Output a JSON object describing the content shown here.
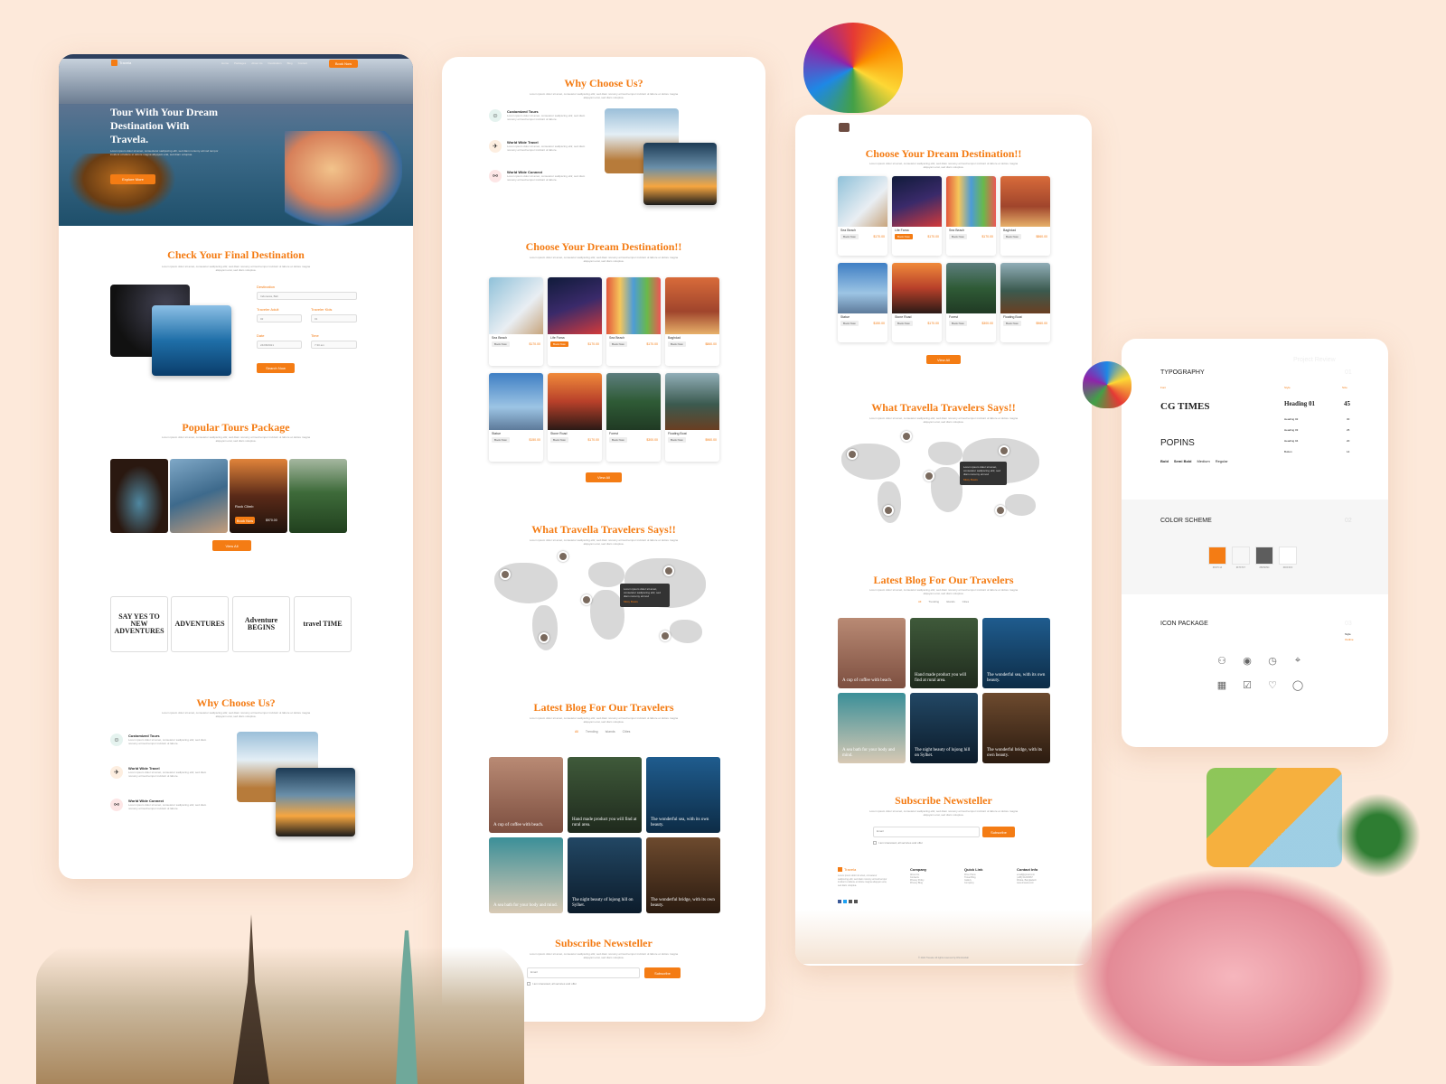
{
  "hero": {
    "brand": "Travela",
    "nav": [
      "Home",
      "Packages",
      "About Us",
      "Destination",
      "Blog",
      "Contact"
    ],
    "nav_button": "Book Now",
    "title": "Tour With Your Dream Destination With Travela.",
    "text": "Lorem ipsum dolor sit amet, consectetur sadipscing elitr, sed diam nonumy eirmod tempor invidunt ut labore et dolore magna aliquyam erat, sed diam voluptua.",
    "cta": "Explore More"
  },
  "check": {
    "title": "Check Your Final Destination",
    "text": "Lorem ipsum dolor sit amet, consetetur sadipscing elitr, sed diam nonumy eirmod tempor invidunt ut labore et dolore magna aliquyam erat, sed diam voluptua.",
    "destination_label": "Destination",
    "destination_value": "Indonesia, Bali",
    "adult_label": "Traveler Adult",
    "adult_value": "02",
    "kids_label": "Traveler Kids",
    "kids_value": "01",
    "date_label": "Date",
    "date_value": "24/08/2021",
    "time_label": "Time",
    "time_value": "7:30 am",
    "button": "Search Now"
  },
  "popular": {
    "title": "Popular Tours Package",
    "text": "Lorem ipsum dolor sit amet, consetetur sadipscing elitr, sed diam nonumy eirmod tempor invidunt ut labore et dolore magna aliquyam erat, sed diam voluptua.",
    "featured_name": "Rock Climb",
    "featured_button": "Book Now",
    "featured_price": "$970.00",
    "button": "View All"
  },
  "logos": [
    "SAY YES TO NEW ADVENTURES",
    "ADVENTURES",
    "Adventure BEGINS",
    "travel TIME"
  ],
  "why": {
    "title": "Why Choose Us?",
    "text": "Lorem ipsum dolor sit amet, consetetur sadipscing elitr, sed diam nonumy eirmod tempor invidunt ut labore et dolore magna aliquyam erat, sed diam voluptua.",
    "features": [
      {
        "title": "Customized Tours",
        "text": "Lorem ipsum dolor sit amet, consetetur sadipscing elitr, sed diam nonumy eirmod tempor invidunt ut labore."
      },
      {
        "title": "World Wide Travel",
        "text": "Lorem ipsum dolor sit amet, consetetur sadipscing elitr, sed diam nonumy eirmod tempor invidunt ut labore."
      },
      {
        "title": "World Wide Connect",
        "text": "Lorem ipsum dolor sit amet, consetetur sadipscing elitr, sed diam nonumy eirmod tempor invidunt ut labore."
      }
    ]
  },
  "dream": {
    "title": "Choose Your Dream Destination!!",
    "text": "Lorem ipsum dolor sit amet, consetetur sadipscing elitr, sed diam nonumy eirmod tempor invidunt ut labore et dolore magna aliquyam erat, sed diam voluptua.",
    "cards": [
      {
        "name": "Sea Beach",
        "price": "$170.00",
        "book": "Book Now"
      },
      {
        "name": "Life Fama",
        "price": "$170.00",
        "book": "Book Now"
      },
      {
        "name": "Sea Beach",
        "price": "$170.00",
        "book": "Book Now"
      },
      {
        "name": "Baghdad",
        "price": "$860.00",
        "book": "Book Now"
      },
      {
        "name": "Statue",
        "price": "$150.00",
        "book": "Book Now"
      },
      {
        "name": "Stone Road",
        "price": "$170.00",
        "book": "Book Now"
      },
      {
        "name": "Forest",
        "price": "$300.00",
        "book": "Book Now"
      },
      {
        "name": "Floating Boat",
        "price": "$960.00",
        "book": "Book Now"
      }
    ],
    "button": "View All"
  },
  "travelers": {
    "title": "What Travella Travelers Says!!",
    "text": "Lorem ipsum dolor sit amet, consetetur sadipscing elitr, sed diam nonumy eirmod tempor invidunt ut labore et dolore magna aliquyam erat, sed diam voluptua.",
    "quote": "Lorem ipsum dolor sit amet, consetetur sadipscing elitr, sed diam nonumy eirmod",
    "author": "Misty Bowls"
  },
  "blog": {
    "title": "Latest Blog For Our Travelers",
    "text": "Lorem ipsum dolor sit amet, consetetur sadipscing elitr, sed diam nonumy eirmod tempor invidunt ut labore et dolore magna aliquyam erat, sed diam voluptua.",
    "tabs": [
      "All",
      "Trending",
      "Islands",
      "Cities"
    ],
    "posts": [
      "A cup of coffee with beach.",
      "Hand made product you will find at rural area.",
      "The wonderful sea, with its own beauty.",
      "A sea bath for your body and mind.",
      "The night beauty of lojong hill on Sylhet.",
      "The wonderful bridge, with its own beauty."
    ]
  },
  "newsletter": {
    "title": "Subscribe Newsteller",
    "text": "Lorem ipsum dolor sit amet, consetetur sadipscing elitr, sed diam nonumy eirmod tempor invidunt ut labore et dolore magna aliquyam erat, sed diam voluptua.",
    "placeholder": "Email",
    "button": "Subscribe",
    "agree": "I am interested, all services and offer"
  },
  "footer": {
    "brand": "Travela",
    "about": "Lorem ipsum dolor sit amet, consetetur sadipscing elitr, sed diam nonumy eirmod tempor invidunt ut labore et dolore magna aliquyam erat, sed diam voluptua.",
    "cols": [
      {
        "title": "Company",
        "items": [
          "About Us",
          "Contacts",
          "Privacy Policy",
          "Privacy Blog"
        ]
      },
      {
        "title": "Quick Link",
        "items": [
          "Price Plans",
          "Travel Blog",
          "Gallery",
          "Company"
        ]
      },
      {
        "title": "Contact Info",
        "items": [
          "email@gmail.com",
          "(+88) 01234567",
          "Dhaka, Bangladesh",
          "www.travela.com"
        ]
      }
    ],
    "copyright": "© 2021 Travela. All rights reserved by Dhruboshah"
  },
  "style": {
    "project_label": "Project Review",
    "typography_title": "TYPOGRAPHY",
    "typography_num": "01",
    "font_label": "Font",
    "style_label": "Style",
    "size_label": "Size",
    "font1": "CG TIMES",
    "font2": "POPINS",
    "heading": "Heading 01",
    "heading_size": "45",
    "sub_headings": [
      "Heading 02",
      "Heading 03",
      "Heading 04",
      "Button"
    ],
    "sub_sizes": [
      "30",
      "25",
      "20",
      "14"
    ],
    "weights": [
      "Bold",
      "Semi Bold",
      "Medium",
      "Regular"
    ],
    "color_title": "COLOR SCHEME",
    "color_num": "02",
    "colors": [
      "#F47C14",
      "#F7F7F7",
      "#5D5D5D",
      "#FFFFFF"
    ],
    "color_names": [
      "#F47C14",
      "#F7F7F7",
      "#5D5D5D",
      "#FFFFFF"
    ],
    "icon_title": "ICON PACKAGE",
    "icon_num": "03",
    "icon_style": "Style",
    "icon_style_value": "Outline"
  }
}
